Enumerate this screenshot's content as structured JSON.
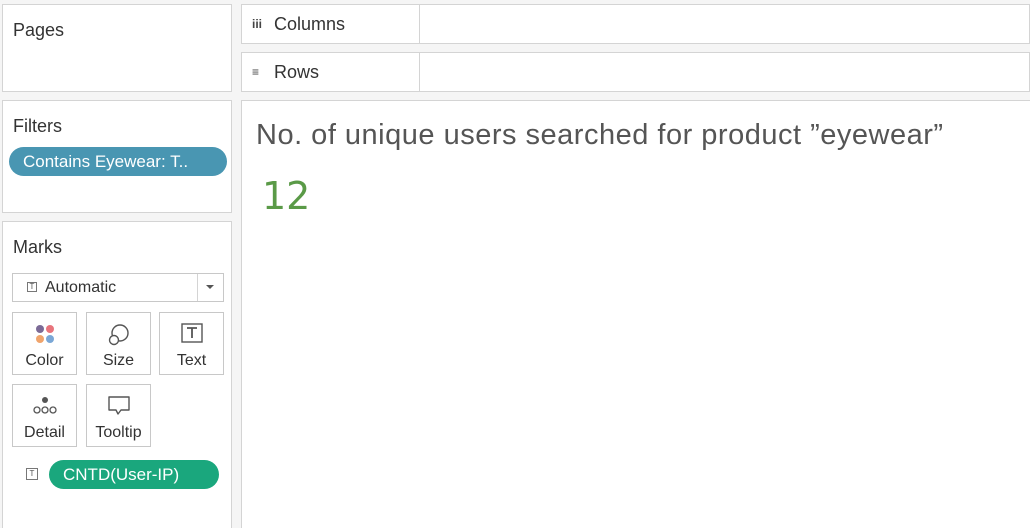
{
  "pages": {
    "title": "Pages"
  },
  "filters": {
    "title": "Filters",
    "pill_label": "Contains Eyewear: T.."
  },
  "marks": {
    "title": "Marks",
    "mark_type": "Automatic",
    "buttons": {
      "color": "Color",
      "size": "Size",
      "text": "Text",
      "detail": "Detail",
      "tooltip": "Tooltip"
    },
    "field_pill": "CNTD(User-IP)",
    "field_pill_color": "#1aa77d",
    "filter_pill_color": "#4996b2"
  },
  "shelves": {
    "columns": "Columns",
    "rows": "Rows"
  },
  "view": {
    "title": "No. of unique users searched for product ”eyewear”",
    "value": "12",
    "value_color": "#5a9a47"
  }
}
